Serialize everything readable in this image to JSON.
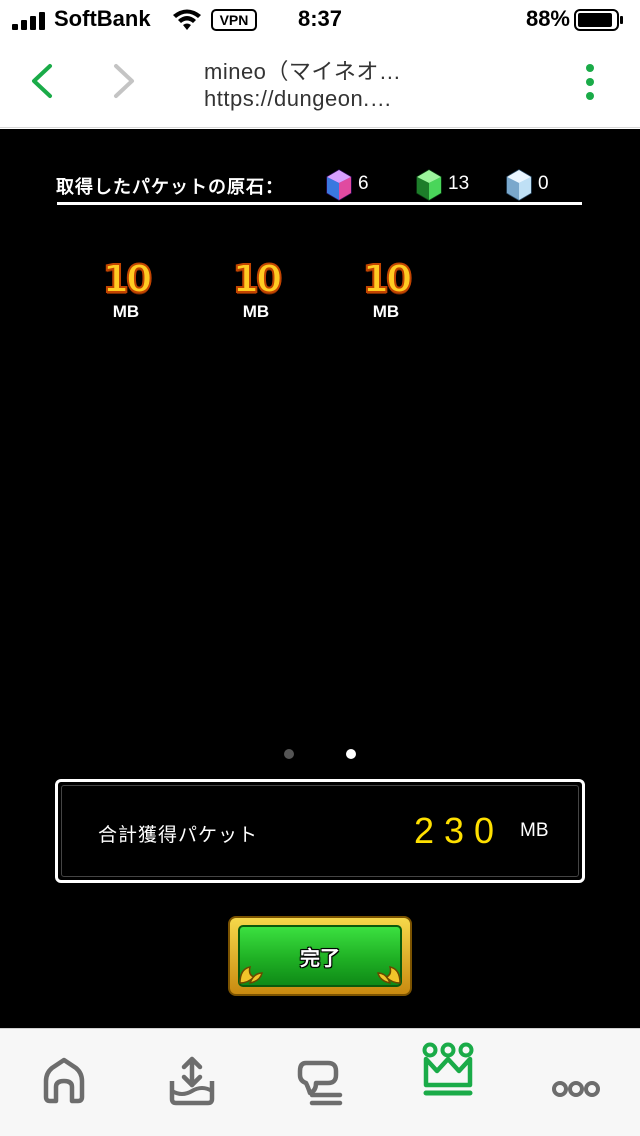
{
  "status_bar": {
    "carrier": "SoftBank",
    "vpn": "VPN",
    "time": "8:37",
    "battery": "88%"
  },
  "browser": {
    "title": "mineo（マイネオ…",
    "url": "https://dungeon.…",
    "accent_color": "#1aab48"
  },
  "game": {
    "stones_label": "取得したパケットの原石：",
    "stones": [
      {
        "icon": "purple-gem-icon",
        "count": "6"
      },
      {
        "icon": "green-gem-icon",
        "count": "13"
      },
      {
        "icon": "blue-gem-icon",
        "count": "0"
      }
    ],
    "packets": [
      {
        "value": "10",
        "unit": "MB"
      },
      {
        "value": "10",
        "unit": "MB"
      },
      {
        "value": "10",
        "unit": "MB"
      }
    ],
    "pager": {
      "pages": 2,
      "current": 2
    },
    "total": {
      "label": "合計獲得パケット",
      "value": "230",
      "unit": "MB",
      "value_color": "#ffe000"
    },
    "done_button": "完了"
  },
  "tab_bar": {
    "items": [
      {
        "icon": "home-icon"
      },
      {
        "icon": "upload-tray-icon"
      },
      {
        "icon": "chat-icon"
      },
      {
        "icon": "crown-icon",
        "active": true
      },
      {
        "icon": "more-icon"
      }
    ],
    "active_color": "#1aab48",
    "inactive_color": "#6d6d6d"
  }
}
